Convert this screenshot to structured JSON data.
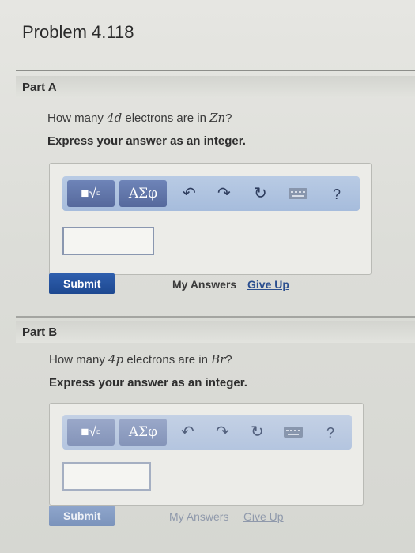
{
  "problem": {
    "title": "Problem 4.118"
  },
  "part_a": {
    "label": "Part A",
    "question_pre": "How many ",
    "question_orbital": "4d",
    "question_mid": " electrons are in ",
    "question_element": "Zn",
    "question_end": "?",
    "instruction": "Express your answer as an integer.",
    "toolbar": {
      "templates_label": "■√▫",
      "symbols_label": "ΑΣφ",
      "undo_icon": "undo-icon",
      "redo_icon": "redo-icon",
      "reset_icon": "reset-icon",
      "keyboard_icon": "keyboard-icon",
      "help_label": "?"
    },
    "answer_value": "",
    "submit_label": "Submit",
    "my_answers_label": "My Answers",
    "give_up_label": "Give Up"
  },
  "part_b": {
    "label": "Part B",
    "question_pre": "How many ",
    "question_orbital": "4p",
    "question_mid": " electrons are in ",
    "question_element": "Br",
    "question_end": "?",
    "instruction": "Express your answer as an integer.",
    "toolbar": {
      "templates_label": "■√▫",
      "symbols_label": "ΑΣφ",
      "help_label": "?"
    },
    "answer_value": "",
    "submit_label": "Submit",
    "my_answers_label": "My Answers",
    "give_up_label": "Give Up"
  }
}
